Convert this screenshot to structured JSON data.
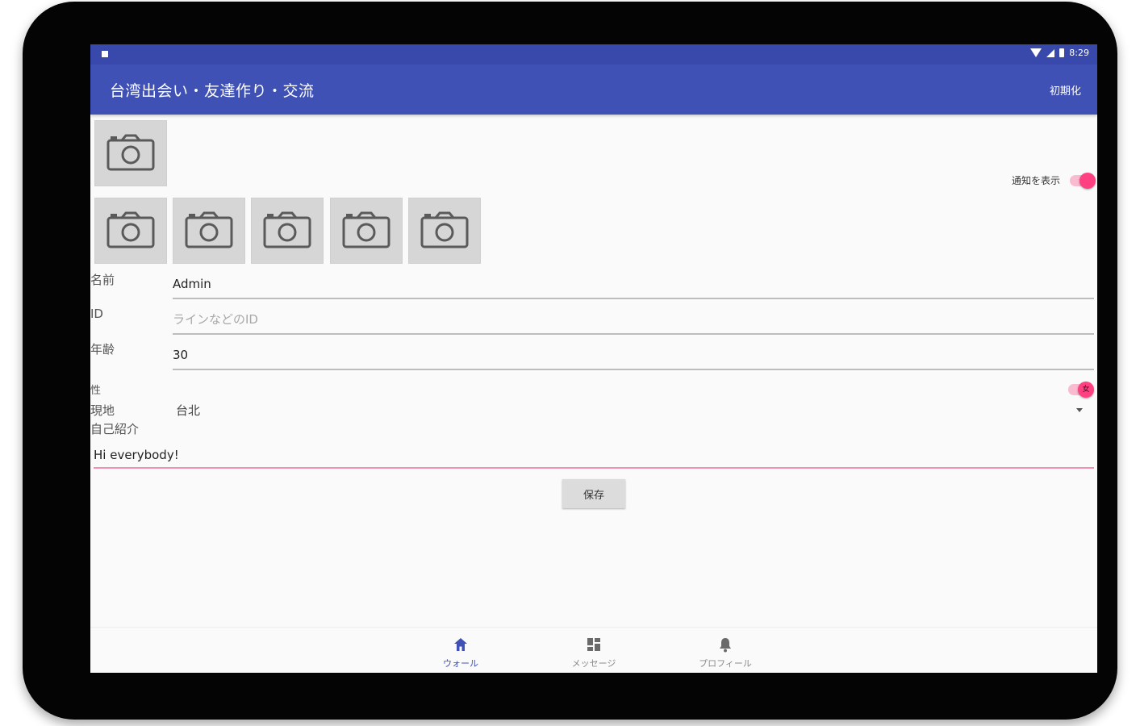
{
  "colors": {
    "primary": "#3f51b5",
    "primary_dark": "#3849ab",
    "accent": "#ff4081",
    "accent_light": "#f8bbd0"
  },
  "status_bar": {
    "time": "8:29"
  },
  "app_bar": {
    "title": "台湾出会い・友達作り・交流",
    "reset_label": "初期化"
  },
  "photos": {
    "icon": "camera-icon",
    "count": 6
  },
  "notification": {
    "label": "通知を表示",
    "enabled": true
  },
  "form": {
    "name": {
      "label": "名前",
      "value": "Admin"
    },
    "id": {
      "label": "ID",
      "value": "",
      "placeholder": "ラインなどのID"
    },
    "age": {
      "label": "年齢",
      "value": "30"
    },
    "gender": {
      "label": "性",
      "toggle_text": "女",
      "enabled": true
    },
    "location": {
      "label": "現地",
      "value": "台北"
    },
    "intro": {
      "label": "自己紹介",
      "value": "Hi everybody!"
    }
  },
  "save_label": "保存",
  "bottom_nav": [
    {
      "label": "ウォール",
      "icon": "home-icon",
      "active": true
    },
    {
      "label": "メッセージ",
      "icon": "dashboard-icon",
      "active": false
    },
    {
      "label": "プロフィール",
      "icon": "bell-icon",
      "active": false
    }
  ]
}
